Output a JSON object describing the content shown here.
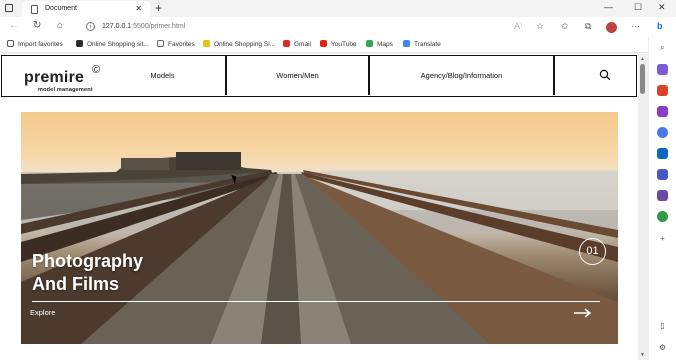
{
  "browser": {
    "tab_title": "Document",
    "url_host": "127.0.0.1",
    "url_path": ":5500/primer.html",
    "favorites": [
      {
        "label": "Import favorites",
        "color": "#555555"
      },
      {
        "label": "Online Shopping sit...",
        "color": "#2a2a2a"
      },
      {
        "label": "Favorites",
        "color": "#666666"
      },
      {
        "label": "Online Shopping Si...",
        "color": "#e8c21a"
      },
      {
        "label": "Gmail",
        "color": "#d93025"
      },
      {
        "label": "YouTube",
        "color": "#e62117"
      },
      {
        "label": "Maps",
        "color": "#34a853"
      },
      {
        "label": "Translate",
        "color": "#4285f4"
      }
    ]
  },
  "site": {
    "logo": "premire",
    "logo_mark": "©",
    "tagline": "model management",
    "nav": [
      "Models",
      "Women/Men",
      "Agency/Blog/Information"
    ]
  },
  "hero": {
    "title_line1": "Photography",
    "title_line2": "And Films",
    "slide_number": "01",
    "cta": "Explore"
  }
}
